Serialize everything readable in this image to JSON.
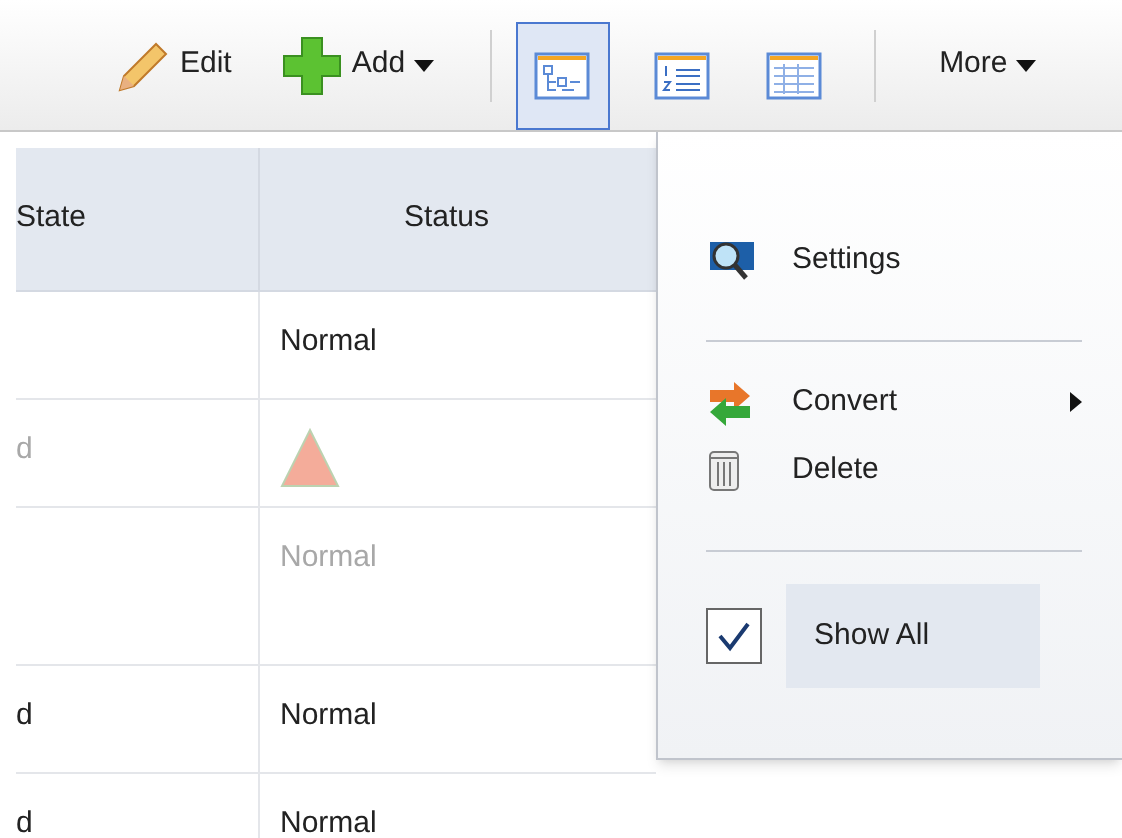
{
  "toolbar": {
    "edit": "Edit",
    "add": "Add",
    "views": [
      {
        "kind": "tree",
        "selected": true
      },
      {
        "kind": "list",
        "selected": false
      },
      {
        "kind": "table",
        "selected": false
      }
    ],
    "more": "More"
  },
  "table": {
    "columns": [
      "State",
      "Status"
    ],
    "rows": [
      {
        "state": "",
        "status": {
          "kind": "text",
          "text": "Normal"
        },
        "dimmed": false
      },
      {
        "state": "d",
        "status": {
          "kind": "warning"
        },
        "dimmed": true
      },
      {
        "state": "",
        "status": {
          "kind": "text",
          "text": "Normal"
        },
        "dimmed": true
      },
      {
        "state": "d",
        "status": {
          "kind": "text",
          "text": "Normal"
        },
        "dimmed": false
      },
      {
        "state": "d",
        "status": {
          "kind": "text",
          "text": "Normal"
        },
        "dimmed": false
      }
    ]
  },
  "menu": {
    "items": [
      {
        "kind": "item",
        "label": "Settings",
        "submenu": false,
        "selected": false
      },
      {
        "kind": "separator"
      },
      {
        "kind": "item",
        "label": "Convert",
        "submenu": true,
        "selected": false
      },
      {
        "kind": "item",
        "label": "Delete",
        "submenu": false,
        "selected": false
      },
      {
        "kind": "separator"
      },
      {
        "kind": "check",
        "label": "Show All",
        "checked": true,
        "selected": true
      }
    ]
  }
}
